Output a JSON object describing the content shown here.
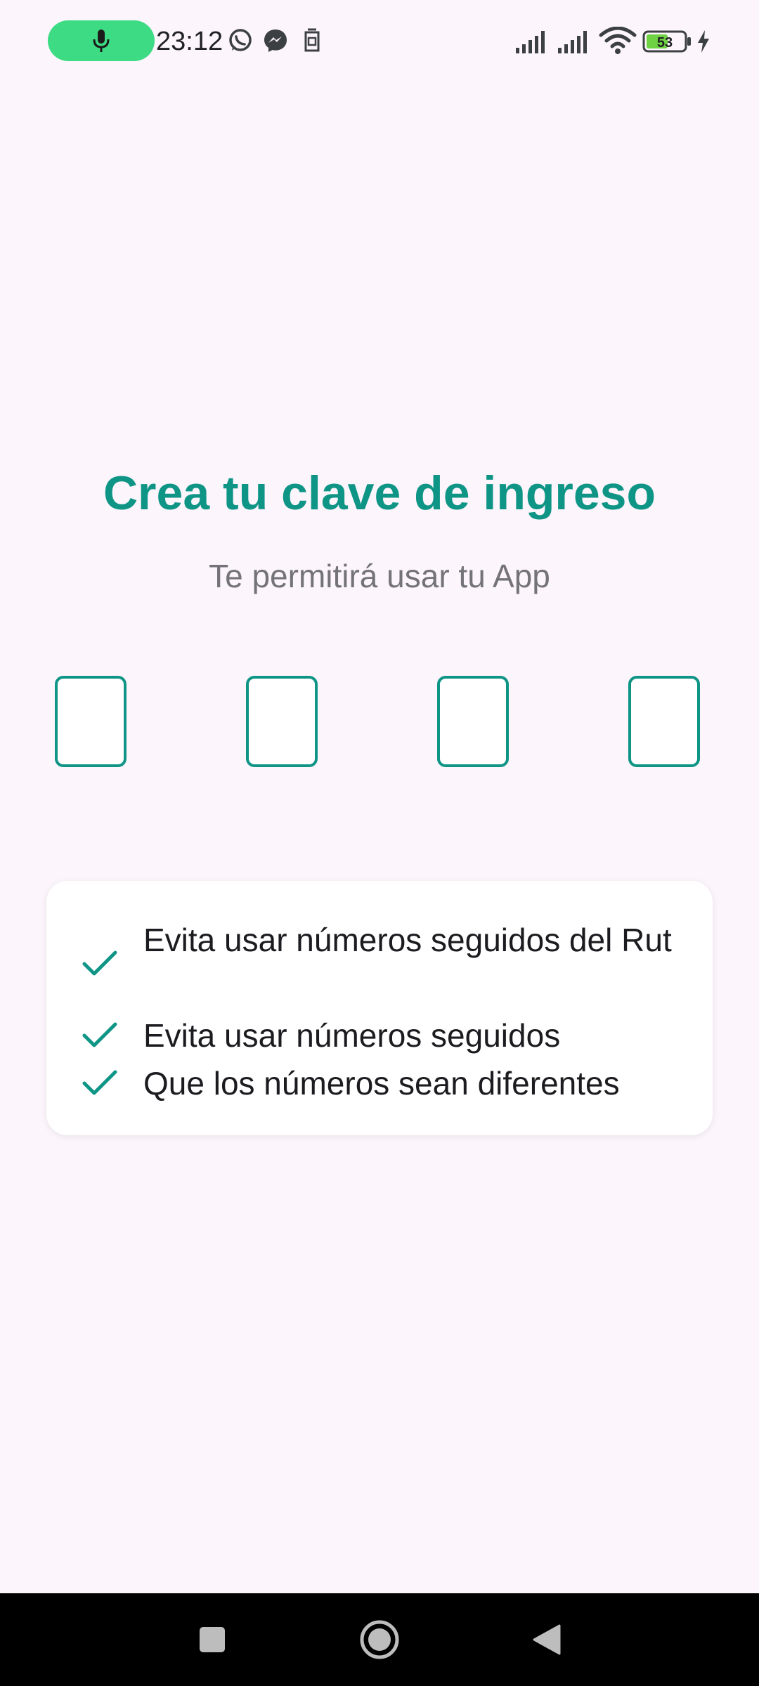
{
  "status_bar": {
    "time": "23:12",
    "battery_level": "53",
    "mic_active_color": "#3ddc84",
    "icons": [
      "mic-icon",
      "whatsapp-icon",
      "messenger-icon",
      "sim-icon",
      "signal-icon",
      "signal-icon",
      "wifi-icon",
      "battery-icon",
      "charging-icon"
    ]
  },
  "main": {
    "title": "Crea tu clave de ingreso",
    "subtitle": "Te permitirá usar tu App",
    "pin": {
      "length": 4,
      "values": [
        "",
        "",
        "",
        ""
      ]
    },
    "rules": [
      {
        "icon": "check-icon",
        "text": "Evita usar números seguidos del Rut"
      },
      {
        "icon": "check-icon",
        "text": "Evita usar números seguidos"
      },
      {
        "icon": "check-icon",
        "text": "Que los números sean diferentes"
      }
    ]
  },
  "nav_bar": {
    "buttons": [
      "recents-button",
      "home-button",
      "back-button"
    ]
  },
  "colors": {
    "accent": "#0f9586",
    "background": "#fcf5fc",
    "subtitle": "#75737a",
    "text": "#1c1b1f"
  }
}
